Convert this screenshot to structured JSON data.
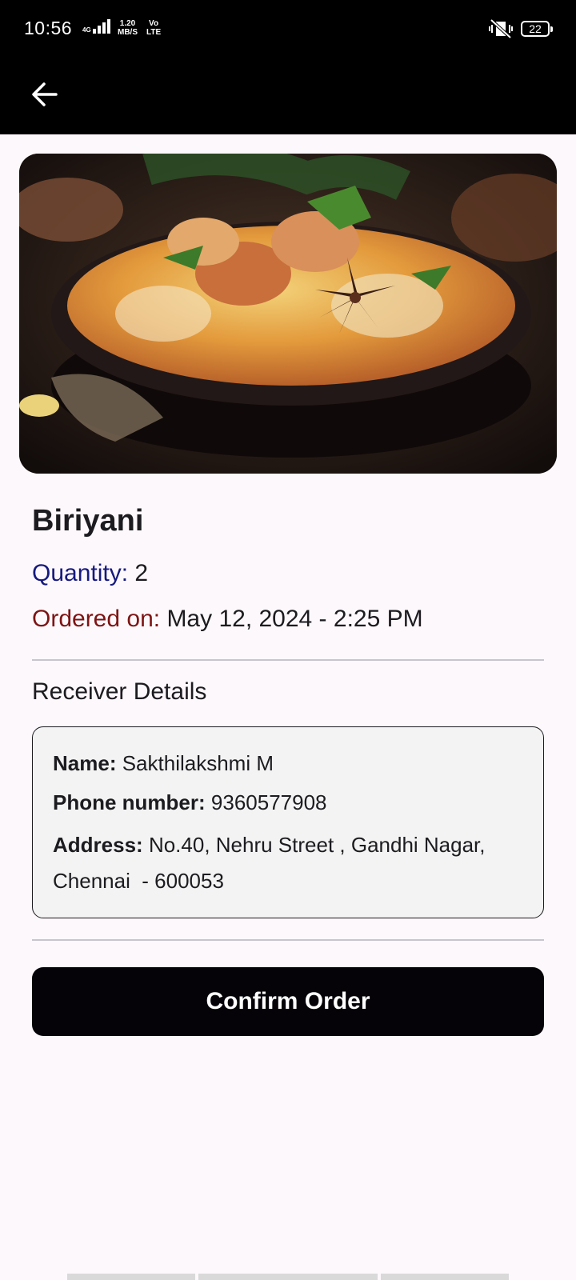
{
  "status_bar": {
    "time": "10:56",
    "network": "4G",
    "speed_value": "1.20",
    "speed_unit": "MB/S",
    "volte_top": "Vo",
    "volte_bottom": "LTE",
    "battery": "22"
  },
  "order": {
    "item_name": "Biriyani",
    "quantity_label": "Quantity:",
    "quantity_value": "2",
    "ordered_on_label": "Ordered on:",
    "ordered_on_value": "May 12, 2024 - 2:25 PM"
  },
  "receiver": {
    "section_title": "Receiver Details",
    "name_label": "Name:",
    "name_value": "Sakthilakshmi M",
    "phone_label": "Phone number:",
    "phone_value": "9360577908",
    "address_label": "Address:",
    "address_line1": "No.40, Nehru Street , Gandhi Nagar,",
    "address_line2": "Chennai  - 600053"
  },
  "actions": {
    "confirm_label": "Confirm Order"
  },
  "colors": {
    "app_bar": "#000000",
    "quantity_label": "#161a7d",
    "ordered_on_label": "#7d1414",
    "button": "#050308"
  }
}
